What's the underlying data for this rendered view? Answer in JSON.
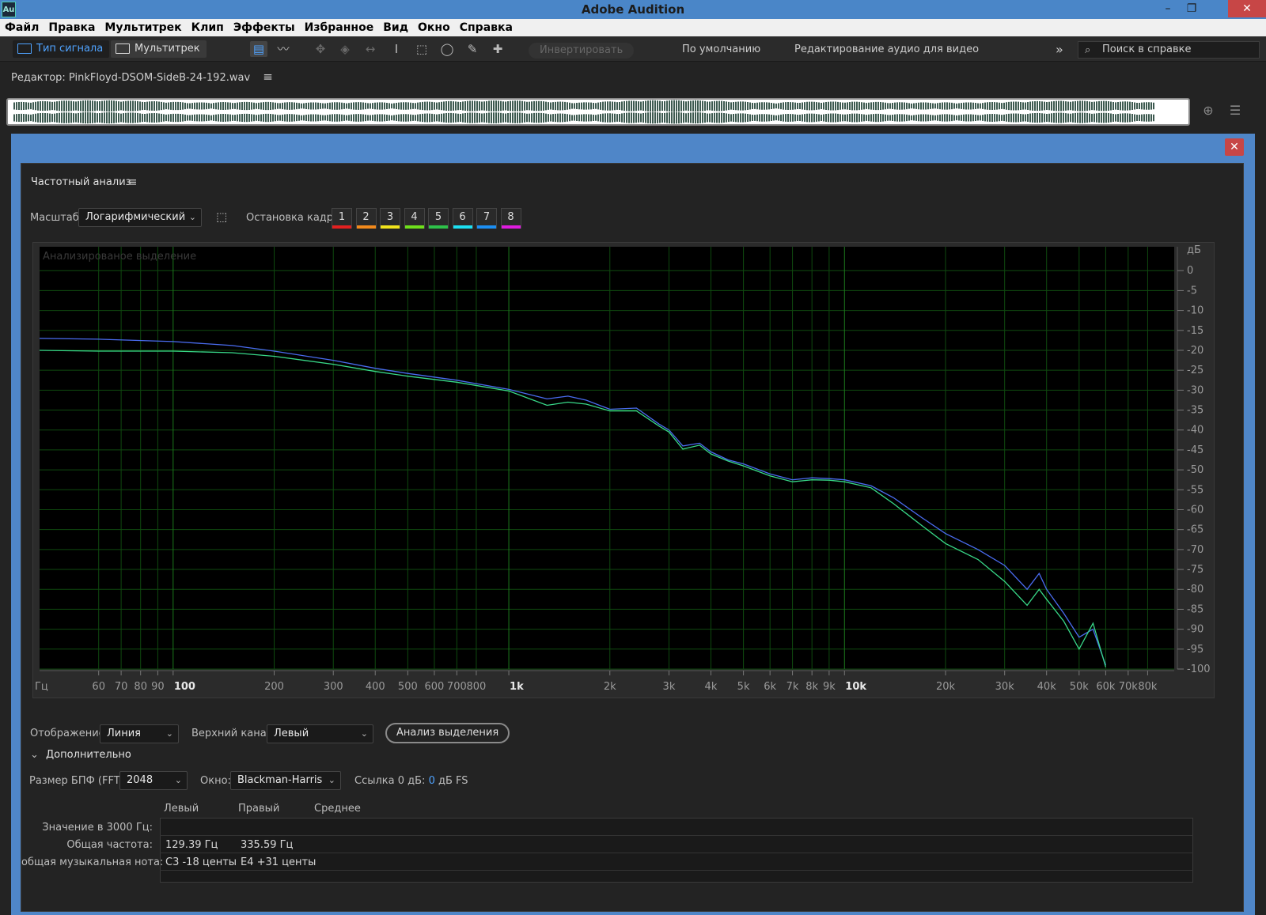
{
  "app": {
    "title": "Adobe Audition",
    "icon_text": "Au",
    "window_buttons": {
      "minimize": "–",
      "restore": "❐",
      "close": "✕"
    }
  },
  "menu": [
    "Файл",
    "Правка",
    "Мультитрек",
    "Клип",
    "Эффекты",
    "Избранное",
    "Вид",
    "Окно",
    "Справка"
  ],
  "toolbar": {
    "waveform_label": "Тип сигнала",
    "multitrack_label": "Мультитрек",
    "invert_label": "Инвертировать",
    "workspace_default": "По умолчанию",
    "workspace_video": "Редактирование аудио для видео",
    "overflow": "»",
    "help_placeholder": "Поиск в справке"
  },
  "editor": {
    "title": "Редактор: PinkFloyd-DSOM-SideB-24-192.wav"
  },
  "dialog": {
    "close": "✕",
    "panel_title": "Частотный анализ",
    "scale_label": "Масштаб:",
    "scale_value": "Логарифмический",
    "freeze_label": "Остановка кадра:",
    "freeze_frames": [
      {
        "label": "1",
        "color": "#e32020"
      },
      {
        "label": "2",
        "color": "#f28a1c"
      },
      {
        "label": "3",
        "color": "#f2e41c"
      },
      {
        "label": "4",
        "color": "#6fe01c"
      },
      {
        "label": "5",
        "color": "#2ec24a"
      },
      {
        "label": "6",
        "color": "#1ce0f2"
      },
      {
        "label": "7",
        "color": "#1c8ef2"
      },
      {
        "label": "8",
        "color": "#e01ce0"
      }
    ],
    "display_label": "Отображение:",
    "display_value": "Линия",
    "top_channel_label": "Верхний канал:",
    "top_channel_value": "Левый",
    "analyze_button": "Анализ выделения",
    "advanced_label": "Дополнительно",
    "fft_label": "Размер БПФ (FFT):",
    "fft_value": "2048",
    "window_label": "Окно:",
    "window_value": "Blackman-Harris",
    "ref_label": "Ссылка 0 дБ:",
    "ref_value": "0",
    "ref_unit": "дБ FS",
    "table": {
      "columns": [
        "Левый",
        "Правый",
        "Среднее"
      ],
      "rows": [
        {
          "label": "Значение в 3000 Гц:",
          "left": "",
          "right": ""
        },
        {
          "label": "Общая частота:",
          "left": "129.39 Гц",
          "right": "335.59 Гц"
        },
        {
          "label": "общая музыкальная нота:",
          "left": "C3 -18 центы",
          "right": "E4 +31 центы"
        }
      ]
    }
  },
  "chart_data": {
    "type": "line",
    "overlay_label": "Анализированое выделение",
    "x_scale": "log",
    "xlim": [
      40,
      96000
    ],
    "ylim": [
      -100,
      6
    ],
    "x_unit_label": "Гц",
    "y_unit_label": "дБ",
    "x_ticks": [
      {
        "v": 60,
        "t": "60"
      },
      {
        "v": 70,
        "t": "70"
      },
      {
        "v": 80,
        "t": "80"
      },
      {
        "v": 90,
        "t": "90"
      },
      {
        "v": 100,
        "t": "100",
        "major": true
      },
      {
        "v": 200,
        "t": "200"
      },
      {
        "v": 300,
        "t": "300"
      },
      {
        "v": 400,
        "t": "400"
      },
      {
        "v": 500,
        "t": "500"
      },
      {
        "v": 600,
        "t": "600"
      },
      {
        "v": 700,
        "t": "700"
      },
      {
        "v": 800,
        "t": "800"
      },
      {
        "v": 1000,
        "t": "1k",
        "major": true
      },
      {
        "v": 2000,
        "t": "2k"
      },
      {
        "v": 3000,
        "t": "3k"
      },
      {
        "v": 4000,
        "t": "4k"
      },
      {
        "v": 5000,
        "t": "5k"
      },
      {
        "v": 6000,
        "t": "6k"
      },
      {
        "v": 7000,
        "t": "7k"
      },
      {
        "v": 8000,
        "t": "8k"
      },
      {
        "v": 9000,
        "t": "9k"
      },
      {
        "v": 10000,
        "t": "10k",
        "major": true
      },
      {
        "v": 20000,
        "t": "20k"
      },
      {
        "v": 30000,
        "t": "30k"
      },
      {
        "v": 40000,
        "t": "40k"
      },
      {
        "v": 50000,
        "t": "50k"
      },
      {
        "v": 60000,
        "t": "60k"
      },
      {
        "v": 70000,
        "t": "70k"
      },
      {
        "v": 80000,
        "t": "80k"
      }
    ],
    "y_ticks": [
      0,
      -5,
      -10,
      -15,
      -20,
      -25,
      -30,
      -35,
      -40,
      -45,
      -50,
      -55,
      -60,
      -65,
      -70,
      -75,
      -80,
      -85,
      -90,
      -95,
      -100
    ],
    "grid": true,
    "colors": {
      "grid": "#0f4a0f",
      "grid_major": "#1c7a1c",
      "background": "#000000"
    },
    "series": [
      {
        "color": "#4a6cf0",
        "points": [
          [
            40,
            -17
          ],
          [
            60,
            -17.2
          ],
          [
            100,
            -17.8
          ],
          [
            150,
            -18.8
          ],
          [
            200,
            -20.2
          ],
          [
            300,
            -22.5
          ],
          [
            400,
            -24.5
          ],
          [
            500,
            -25.8
          ],
          [
            700,
            -27.5
          ],
          [
            1000,
            -29.8
          ],
          [
            1300,
            -32.2
          ],
          [
            1500,
            -31.5
          ],
          [
            1700,
            -32.5
          ],
          [
            2000,
            -34.8
          ],
          [
            2400,
            -34.5
          ],
          [
            2800,
            -38.5
          ],
          [
            3000,
            -40
          ],
          [
            3300,
            -44
          ],
          [
            3700,
            -43.3
          ],
          [
            4000,
            -45.5
          ],
          [
            4500,
            -47.5
          ],
          [
            5000,
            -48.5
          ],
          [
            6000,
            -51
          ],
          [
            7000,
            -52.5
          ],
          [
            8000,
            -52
          ],
          [
            9000,
            -52.2
          ],
          [
            10000,
            -52.5
          ],
          [
            12000,
            -54
          ],
          [
            14000,
            -57
          ],
          [
            17000,
            -62
          ],
          [
            20000,
            -66
          ],
          [
            25000,
            -70
          ],
          [
            30000,
            -74
          ],
          [
            35000,
            -80
          ],
          [
            38000,
            -76
          ],
          [
            40000,
            -80
          ],
          [
            45000,
            -86
          ],
          [
            50000,
            -92
          ],
          [
            55000,
            -90
          ],
          [
            60000,
            -99
          ]
        ]
      },
      {
        "color": "#38d888",
        "points": [
          [
            40,
            -20
          ],
          [
            60,
            -20.2
          ],
          [
            100,
            -20.2
          ],
          [
            150,
            -20.6
          ],
          [
            200,
            -21.5
          ],
          [
            300,
            -23.5
          ],
          [
            400,
            -25.3
          ],
          [
            500,
            -26.5
          ],
          [
            700,
            -28
          ],
          [
            1000,
            -30.2
          ],
          [
            1300,
            -33.8
          ],
          [
            1500,
            -33
          ],
          [
            1700,
            -33.5
          ],
          [
            2000,
            -35.2
          ],
          [
            2400,
            -35.2
          ],
          [
            2800,
            -39
          ],
          [
            3000,
            -40.5
          ],
          [
            3300,
            -44.8
          ],
          [
            3700,
            -43.8
          ],
          [
            4000,
            -46
          ],
          [
            4500,
            -47.8
          ],
          [
            5000,
            -49
          ],
          [
            6000,
            -51.5
          ],
          [
            7000,
            -53
          ],
          [
            8000,
            -52.5
          ],
          [
            9000,
            -52.6
          ],
          [
            10000,
            -53
          ],
          [
            12000,
            -54.5
          ],
          [
            14000,
            -58.5
          ],
          [
            17000,
            -64
          ],
          [
            20000,
            -68.5
          ],
          [
            25000,
            -72.5
          ],
          [
            30000,
            -78
          ],
          [
            35000,
            -84
          ],
          [
            38000,
            -80
          ],
          [
            40000,
            -82.5
          ],
          [
            45000,
            -88
          ],
          [
            50000,
            -95
          ],
          [
            55000,
            -88.5
          ],
          [
            60000,
            -99.5
          ]
        ]
      }
    ]
  }
}
